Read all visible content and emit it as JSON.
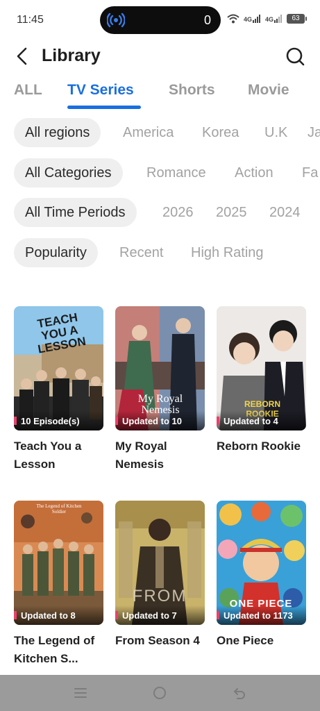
{
  "status": {
    "time": "11:45",
    "island_count": "0",
    "net1": "4G",
    "net2": "4G",
    "battery": "63"
  },
  "header": {
    "title": "Library"
  },
  "tabs": [
    {
      "label": "ALL",
      "active": false
    },
    {
      "label": "TV Series",
      "active": true
    },
    {
      "label": "Shorts",
      "active": false
    },
    {
      "label": "Movie",
      "active": false
    }
  ],
  "filters": {
    "regions": [
      "All regions",
      "America",
      "Korea",
      "U.K",
      "Ja"
    ],
    "categories": [
      "All Categories",
      "Romance",
      "Action",
      "Fa"
    ],
    "periods": [
      "All Time Periods",
      "2026",
      "2025",
      "2024"
    ],
    "sort": [
      "Popularity",
      "Recent",
      "High Rating"
    ]
  },
  "cards": [
    {
      "title": "Teach You a Lesson",
      "badge": "10 Episode(s)",
      "poster_text": "TEACH YOU A LESSON"
    },
    {
      "title": "My Royal Nemesis",
      "badge": "Updated to 10",
      "poster_text": "My Royal Nemesis"
    },
    {
      "title": "Reborn Rookie",
      "badge": "Updated to 4",
      "poster_text": "REBORN ROOKIE"
    },
    {
      "title": "The Legend of Kitchen S...",
      "badge": "Updated to 8",
      "poster_text": "The Legend of Kitchen Soldier"
    },
    {
      "title": "From Season 4",
      "badge": "Updated to 7",
      "poster_text": "FROM"
    },
    {
      "title": "One Piece",
      "badge": "Updated to 1173",
      "poster_text": "ONE PIECE"
    }
  ],
  "colors": {
    "accent": "#1a6fdf",
    "badge_mark": "#e8416b",
    "chip_bg": "#efefef",
    "nav_bar": "#9b9b9b"
  }
}
